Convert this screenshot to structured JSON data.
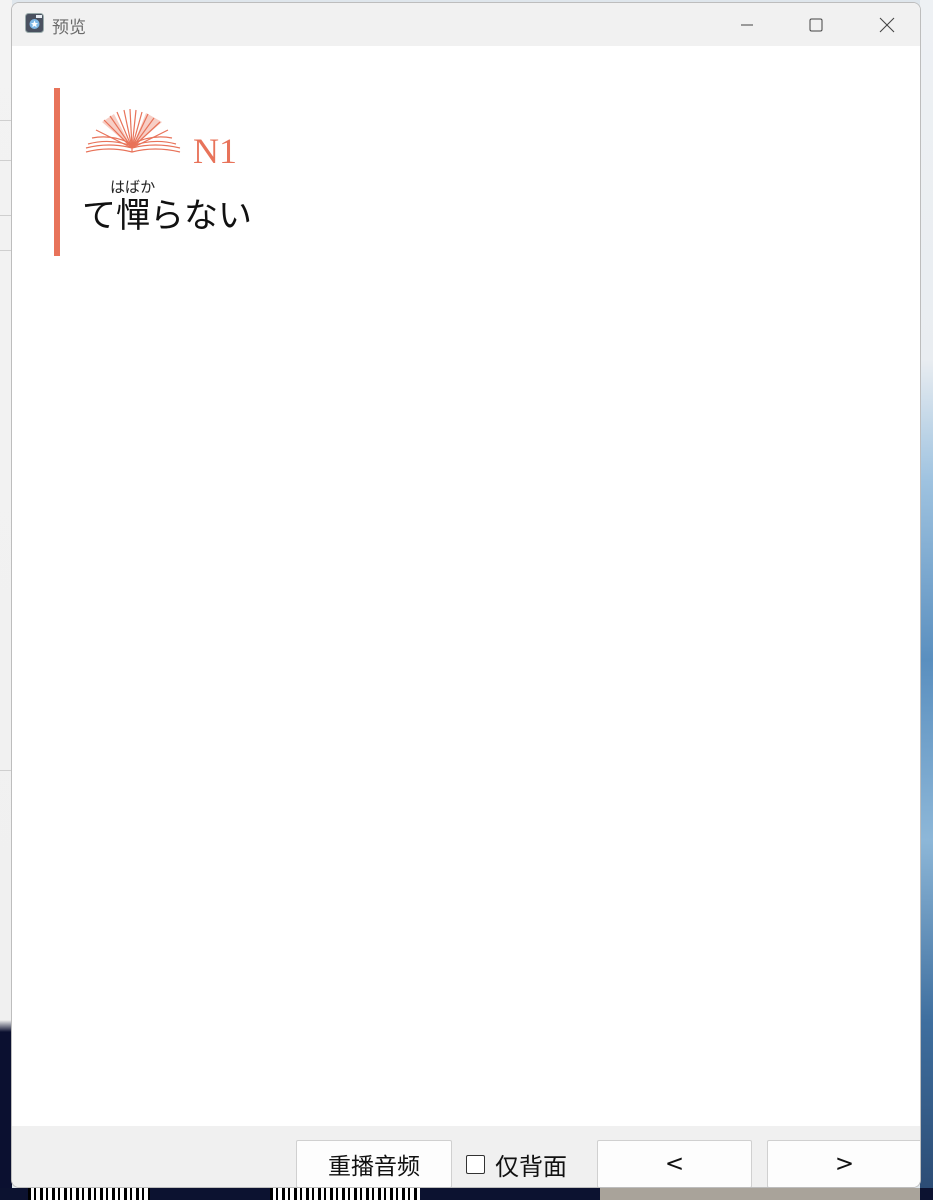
{
  "window": {
    "title": "预览",
    "controls": [
      "minimize-icon",
      "maximize-icon",
      "close-icon"
    ]
  },
  "card": {
    "level": "N1",
    "accent_color": "#e8735a",
    "icon": "open-book-icon",
    "word_prefix": "て",
    "word_kanji": "憚",
    "word_suffix": "らない",
    "furigana": "はばか"
  },
  "footer": {
    "replay_label": "重播音频",
    "back_only_label": "仅背面",
    "back_only_checked": false,
    "prev_label": "<",
    "next_label": ">"
  }
}
